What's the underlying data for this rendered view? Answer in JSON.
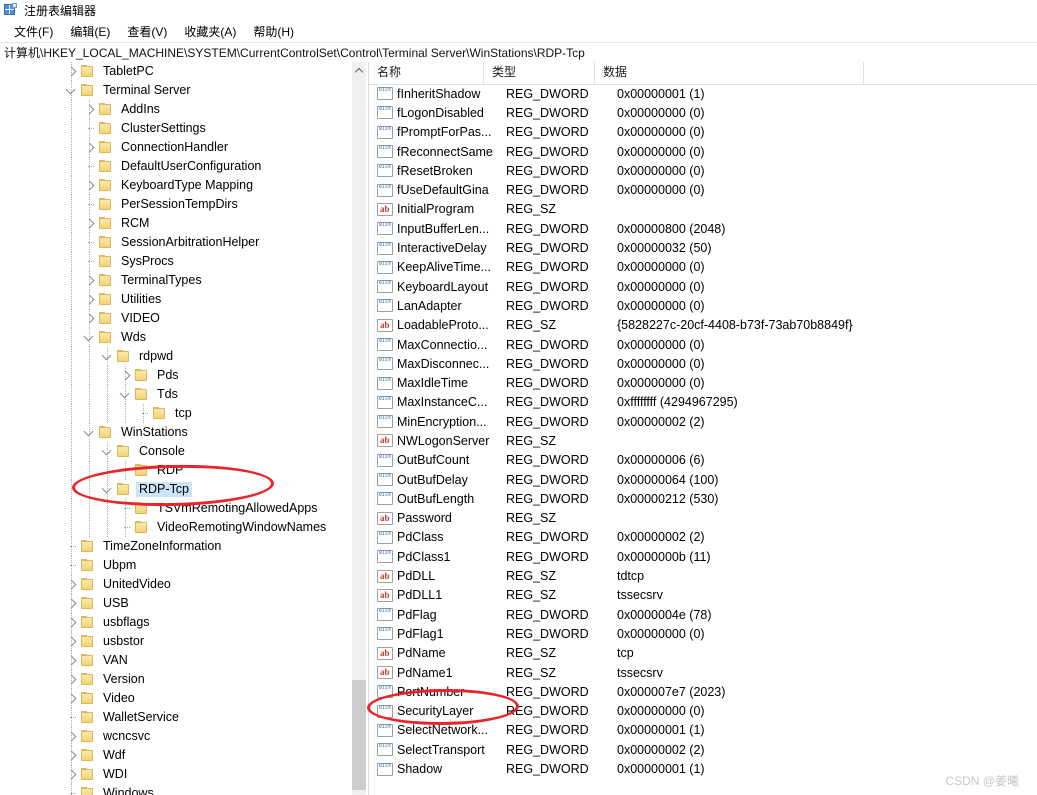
{
  "window": {
    "title": "注册表编辑器",
    "icon": "regedit-icon"
  },
  "menubar": {
    "items": [
      {
        "label": "文件(F)"
      },
      {
        "label": "编辑(E)"
      },
      {
        "label": "查看(V)"
      },
      {
        "label": "收藏夹(A)"
      },
      {
        "label": "帮助(H)"
      }
    ]
  },
  "address": {
    "path": "计算机\\HKEY_LOCAL_MACHINE\\SYSTEM\\CurrentControlSet\\Control\\Terminal Server\\WinStations\\RDP-Tcp"
  },
  "tree": {
    "scrollbar": {
      "up_arrow": "scroll-up-arrow"
    },
    "nodes": [
      {
        "label": "TabletPC",
        "indent": 1,
        "state": "collapsed",
        "selected": false
      },
      {
        "label": "Terminal Server",
        "indent": 1,
        "state": "expanded",
        "selected": false
      },
      {
        "label": "AddIns",
        "indent": 2,
        "state": "collapsed",
        "selected": false
      },
      {
        "label": "ClusterSettings",
        "indent": 2,
        "state": "leaf",
        "selected": false
      },
      {
        "label": "ConnectionHandler",
        "indent": 2,
        "state": "collapsed",
        "selected": false
      },
      {
        "label": "DefaultUserConfiguration",
        "indent": 2,
        "state": "leaf",
        "selected": false
      },
      {
        "label": "KeyboardType Mapping",
        "indent": 2,
        "state": "collapsed",
        "selected": false
      },
      {
        "label": "PerSessionTempDirs",
        "indent": 2,
        "state": "leaf",
        "selected": false
      },
      {
        "label": "RCM",
        "indent": 2,
        "state": "collapsed",
        "selected": false
      },
      {
        "label": "SessionArbitrationHelper",
        "indent": 2,
        "state": "leaf",
        "selected": false
      },
      {
        "label": "SysProcs",
        "indent": 2,
        "state": "leaf",
        "selected": false
      },
      {
        "label": "TerminalTypes",
        "indent": 2,
        "state": "collapsed",
        "selected": false
      },
      {
        "label": "Utilities",
        "indent": 2,
        "state": "collapsed",
        "selected": false
      },
      {
        "label": "VIDEO",
        "indent": 2,
        "state": "collapsed",
        "selected": false
      },
      {
        "label": "Wds",
        "indent": 2,
        "state": "expanded",
        "selected": false
      },
      {
        "label": "rdpwd",
        "indent": 3,
        "state": "expanded",
        "selected": false
      },
      {
        "label": "Pds",
        "indent": 4,
        "state": "collapsed",
        "selected": false
      },
      {
        "label": "Tds",
        "indent": 4,
        "state": "expanded",
        "selected": false
      },
      {
        "label": "tcp",
        "indent": 5,
        "state": "leaf",
        "selected": false
      },
      {
        "label": "WinStations",
        "indent": 2,
        "state": "expanded",
        "selected": false
      },
      {
        "label": "Console",
        "indent": 3,
        "state": "expanded",
        "selected": false
      },
      {
        "label": "RDP",
        "indent": 4,
        "state": "leaf",
        "selected": false
      },
      {
        "label": "RDP-Tcp",
        "indent": 3,
        "state": "expanded",
        "selected": true
      },
      {
        "label": "TSVmRemotingAllowedApps",
        "indent": 4,
        "state": "leaf",
        "selected": false
      },
      {
        "label": "VideoRemotingWindowNames",
        "indent": 4,
        "state": "leaf",
        "selected": false
      },
      {
        "label": "TimeZoneInformation",
        "indent": 1,
        "state": "leaf",
        "selected": false
      },
      {
        "label": "Ubpm",
        "indent": 1,
        "state": "leaf",
        "selected": false
      },
      {
        "label": "UnitedVideo",
        "indent": 1,
        "state": "collapsed",
        "selected": false
      },
      {
        "label": "USB",
        "indent": 1,
        "state": "collapsed",
        "selected": false
      },
      {
        "label": "usbflags",
        "indent": 1,
        "state": "collapsed",
        "selected": false
      },
      {
        "label": "usbstor",
        "indent": 1,
        "state": "collapsed",
        "selected": false
      },
      {
        "label": "VAN",
        "indent": 1,
        "state": "collapsed",
        "selected": false
      },
      {
        "label": "Version",
        "indent": 1,
        "state": "collapsed",
        "selected": false
      },
      {
        "label": "Video",
        "indent": 1,
        "state": "collapsed",
        "selected": false
      },
      {
        "label": "WalletService",
        "indent": 1,
        "state": "leaf",
        "selected": false
      },
      {
        "label": "wcncsvc",
        "indent": 1,
        "state": "collapsed",
        "selected": false
      },
      {
        "label": "Wdf",
        "indent": 1,
        "state": "collapsed",
        "selected": false
      },
      {
        "label": "WDI",
        "indent": 1,
        "state": "collapsed",
        "selected": false
      },
      {
        "label": "Windows",
        "indent": 1,
        "state": "leaf",
        "selected": false
      }
    ]
  },
  "values": {
    "columns": [
      {
        "key": "name",
        "label": "名称"
      },
      {
        "key": "type",
        "label": "类型"
      },
      {
        "key": "data",
        "label": "数据"
      }
    ],
    "rows": [
      {
        "name": "fInheritShadow",
        "type": "REG_DWORD",
        "data": "0x00000001 (1)",
        "icon": "dword-value-icon"
      },
      {
        "name": "fLogonDisabled",
        "type": "REG_DWORD",
        "data": "0x00000000 (0)",
        "icon": "dword-value-icon"
      },
      {
        "name": "fPromptForPas...",
        "type": "REG_DWORD",
        "data": "0x00000000 (0)",
        "icon": "dword-value-icon"
      },
      {
        "name": "fReconnectSame",
        "type": "REG_DWORD",
        "data": "0x00000000 (0)",
        "icon": "dword-value-icon"
      },
      {
        "name": "fResetBroken",
        "type": "REG_DWORD",
        "data": "0x00000000 (0)",
        "icon": "dword-value-icon"
      },
      {
        "name": "fUseDefaultGina",
        "type": "REG_DWORD",
        "data": "0x00000000 (0)",
        "icon": "dword-value-icon"
      },
      {
        "name": "InitialProgram",
        "type": "REG_SZ",
        "data": "",
        "icon": "string-value-icon"
      },
      {
        "name": "InputBufferLen...",
        "type": "REG_DWORD",
        "data": "0x00000800 (2048)",
        "icon": "dword-value-icon"
      },
      {
        "name": "InteractiveDelay",
        "type": "REG_DWORD",
        "data": "0x00000032 (50)",
        "icon": "dword-value-icon"
      },
      {
        "name": "KeepAliveTime...",
        "type": "REG_DWORD",
        "data": "0x00000000 (0)",
        "icon": "dword-value-icon"
      },
      {
        "name": "KeyboardLayout",
        "type": "REG_DWORD",
        "data": "0x00000000 (0)",
        "icon": "dword-value-icon"
      },
      {
        "name": "LanAdapter",
        "type": "REG_DWORD",
        "data": "0x00000000 (0)",
        "icon": "dword-value-icon"
      },
      {
        "name": "LoadableProto...",
        "type": "REG_SZ",
        "data": "{5828227c-20cf-4408-b73f-73ab70b8849f}",
        "icon": "string-value-icon"
      },
      {
        "name": "MaxConnectio...",
        "type": "REG_DWORD",
        "data": "0x00000000 (0)",
        "icon": "dword-value-icon"
      },
      {
        "name": "MaxDisconnec...",
        "type": "REG_DWORD",
        "data": "0x00000000 (0)",
        "icon": "dword-value-icon"
      },
      {
        "name": "MaxIdleTime",
        "type": "REG_DWORD",
        "data": "0x00000000 (0)",
        "icon": "dword-value-icon"
      },
      {
        "name": "MaxInstanceC...",
        "type": "REG_DWORD",
        "data": "0xffffffff (4294967295)",
        "icon": "dword-value-icon"
      },
      {
        "name": "MinEncryption...",
        "type": "REG_DWORD",
        "data": "0x00000002 (2)",
        "icon": "dword-value-icon"
      },
      {
        "name": "NWLogonServer",
        "type": "REG_SZ",
        "data": "",
        "icon": "string-value-icon"
      },
      {
        "name": "OutBufCount",
        "type": "REG_DWORD",
        "data": "0x00000006 (6)",
        "icon": "dword-value-icon"
      },
      {
        "name": "OutBufDelay",
        "type": "REG_DWORD",
        "data": "0x00000064 (100)",
        "icon": "dword-value-icon"
      },
      {
        "name": "OutBufLength",
        "type": "REG_DWORD",
        "data": "0x00000212 (530)",
        "icon": "dword-value-icon"
      },
      {
        "name": "Password",
        "type": "REG_SZ",
        "data": "",
        "icon": "string-value-icon"
      },
      {
        "name": "PdClass",
        "type": "REG_DWORD",
        "data": "0x00000002 (2)",
        "icon": "dword-value-icon"
      },
      {
        "name": "PdClass1",
        "type": "REG_DWORD",
        "data": "0x0000000b (11)",
        "icon": "dword-value-icon"
      },
      {
        "name": "PdDLL",
        "type": "REG_SZ",
        "data": "tdtcp",
        "icon": "string-value-icon"
      },
      {
        "name": "PdDLL1",
        "type": "REG_SZ",
        "data": "tssecsrv",
        "icon": "string-value-icon"
      },
      {
        "name": "PdFlag",
        "type": "REG_DWORD",
        "data": "0x0000004e (78)",
        "icon": "dword-value-icon"
      },
      {
        "name": "PdFlag1",
        "type": "REG_DWORD",
        "data": "0x00000000 (0)",
        "icon": "dword-value-icon"
      },
      {
        "name": "PdName",
        "type": "REG_SZ",
        "data": "tcp",
        "icon": "string-value-icon"
      },
      {
        "name": "PdName1",
        "type": "REG_SZ",
        "data": "tssecsrv",
        "icon": "string-value-icon"
      },
      {
        "name": "PortNumber",
        "type": "REG_DWORD",
        "data": "0x000007e7 (2023)",
        "icon": "dword-value-icon"
      },
      {
        "name": "SecurityLayer",
        "type": "REG_DWORD",
        "data": "0x00000000 (0)",
        "icon": "dword-value-icon"
      },
      {
        "name": "SelectNetwork...",
        "type": "REG_DWORD",
        "data": "0x00000001 (1)",
        "icon": "dword-value-icon"
      },
      {
        "name": "SelectTransport",
        "type": "REG_DWORD",
        "data": "0x00000002 (2)",
        "icon": "dword-value-icon"
      },
      {
        "name": "Shadow",
        "type": "REG_DWORD",
        "data": "0x00000001 (1)",
        "icon": "dword-value-icon"
      }
    ]
  },
  "annotations": {
    "color": "#e8262a",
    "ellipses": [
      {
        "target": "RDP-Tcp"
      },
      {
        "target": "PortNumber"
      }
    ]
  },
  "watermark": {
    "text": "CSDN @姜曦"
  }
}
